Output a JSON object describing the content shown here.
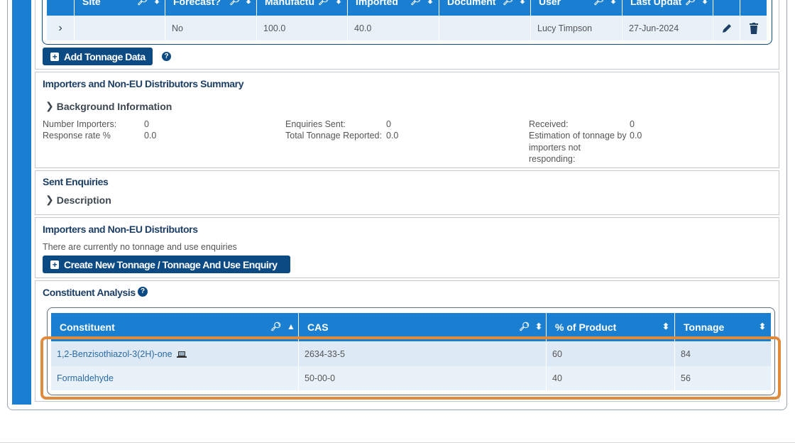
{
  "tonnage_table": {
    "headers": [
      {
        "label": "Site"
      },
      {
        "label": "Forecast?"
      },
      {
        "label": "Manufactu"
      },
      {
        "label": "Imported"
      },
      {
        "label": "Document"
      },
      {
        "label": "User"
      },
      {
        "label": "Last Updat"
      }
    ],
    "row": {
      "site": "",
      "forecast": "No",
      "manufactured": "100.0",
      "imported": "40.0",
      "document": "",
      "user": "Lucy Timpson",
      "last_updated": "27-Jun-2024"
    },
    "add_button_label": "Add Tonnage Data"
  },
  "importers_summary": {
    "title": "Importers and Non-EU Distributors Summary",
    "background_toggle": "Background Information",
    "fields": {
      "number_importers_label": "Number Importers:",
      "number_importers_value": "0",
      "response_rate_label": "Response rate %",
      "response_rate_value": "0.0",
      "enquiries_sent_label": "Enquiries Sent:",
      "enquiries_sent_value": "0",
      "total_tonnage_label": "Total Tonnage Reported:",
      "total_tonnage_value": "0.0",
      "received_label": "Received:",
      "received_value": "0",
      "estimation_label_1": "Estimation of tonnage by",
      "estimation_label_2": "importers not",
      "estimation_label_3": "responding:",
      "estimation_value": "0.0"
    }
  },
  "sent_enquiries": {
    "title": "Sent Enquiries",
    "description_toggle": "Description"
  },
  "importers": {
    "title": "Importers and Non-EU Distributors",
    "empty_text": "There are currently no tonnage and use enquiries",
    "create_button_label": "Create New Tonnage / Tonnage And Use Enquiry"
  },
  "constituent_analysis": {
    "title": "Constituent Analysis",
    "headers": {
      "constituent": "Constituent",
      "cas": "CAS",
      "percent": "% of Product",
      "tonnage": "Tonnage"
    },
    "rows": [
      {
        "constituent": "1,2-Benzisothiazol-3(2H)-one",
        "cas": "2634-33-5",
        "percent": "60",
        "tonnage": "84"
      },
      {
        "constituent": "Formaldehyde",
        "cas": "50-00-0",
        "percent": "40",
        "tonnage": "56"
      }
    ]
  },
  "colors": {
    "header_blue": "#1a7fd0",
    "button_navy": "#0c4a84",
    "row_light": "#e8f1f8",
    "highlight_orange": "#e08a3c"
  },
  "icons": [
    "search-icon",
    "sort-icon",
    "sort-asc-icon",
    "chevron-right-icon",
    "edit-icon",
    "delete-icon",
    "help-icon",
    "plus-icon",
    "laptop-icon"
  ]
}
